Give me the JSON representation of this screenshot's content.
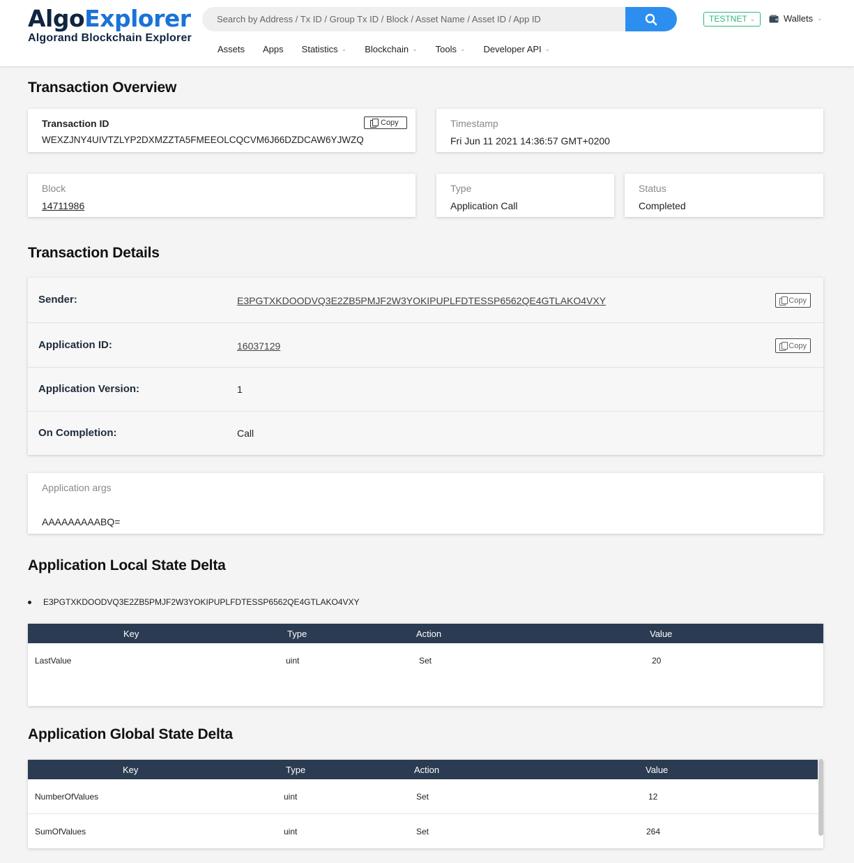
{
  "header": {
    "logo_algo": "Algo",
    "logo_explorer": "Explorer",
    "logo_subtitle": "Algorand Blockchain Explorer",
    "search_placeholder": "Search by Address / Tx ID / Group Tx ID / Block / Asset Name / Asset ID / App ID",
    "search_icon": "search-icon",
    "network": "TESTNET",
    "wallets_label": "Wallets",
    "nav": [
      {
        "label": "Assets",
        "dropdown": false
      },
      {
        "label": "Apps",
        "dropdown": false
      },
      {
        "label": "Statistics",
        "dropdown": true
      },
      {
        "label": "Blockchain",
        "dropdown": true
      },
      {
        "label": "Tools",
        "dropdown": true
      },
      {
        "label": "Developer API",
        "dropdown": true
      }
    ]
  },
  "overview": {
    "title": "Transaction Overview",
    "tx_id_label": "Transaction ID",
    "tx_id": "WEXZJNY4UIVTZLYP2DXMZZTA5FMEEOLCQCVM6J66DZDCAW6YJWZQ",
    "copy_label": "Copy",
    "timestamp_label": "Timestamp",
    "timestamp": "Fri Jun 11 2021 14:36:57 GMT+0200",
    "block_label": "Block",
    "block": "14711986",
    "type_label": "Type",
    "type": "Application Call",
    "status_label": "Status",
    "status": "Completed"
  },
  "details": {
    "title": "Transaction Details",
    "sender_label": "Sender:",
    "sender": "E3PGTXKDOODVQ3E2ZB5PMJF2W3YOKIPUPLFDTESSP6562QE4GTLAKO4VXY",
    "app_id_label": "Application ID:",
    "app_id": "16037129",
    "app_version_label": "Application Version:",
    "app_version": "1",
    "on_completion_label": "On Completion:",
    "on_completion": "Call",
    "copy_label": "Copy"
  },
  "args": {
    "label": "Application args",
    "value": "AAAAAAAAABQ="
  },
  "local_state": {
    "title": "Application Local State Delta",
    "account": "E3PGTXKDOODVQ3E2ZB5PMJF2W3YOKIPUPLFDTESSP6562QE4GTLAKO4VXY",
    "columns": [
      "Key",
      "Type",
      "Action",
      "Value"
    ],
    "rows": [
      {
        "key": "LastValue",
        "type": "uint",
        "action": "Set",
        "value": "20"
      }
    ]
  },
  "global_state": {
    "title": "Application Global State Delta",
    "columns": [
      "Key",
      "Type",
      "Action",
      "Value"
    ],
    "rows": [
      {
        "key": "NumberOfValues",
        "type": "uint",
        "action": "Set",
        "value": "12"
      },
      {
        "key": "SumOfValues",
        "type": "uint",
        "action": "Set",
        "value": "264"
      }
    ]
  },
  "colors": {
    "brand_dark": "#0f2540",
    "brand_blue": "#1a73d6",
    "search_button": "#2c8ff0",
    "testnet": "#2eb67d",
    "status_completed": "#3aa3e3",
    "table_header": "#2b3b52"
  }
}
